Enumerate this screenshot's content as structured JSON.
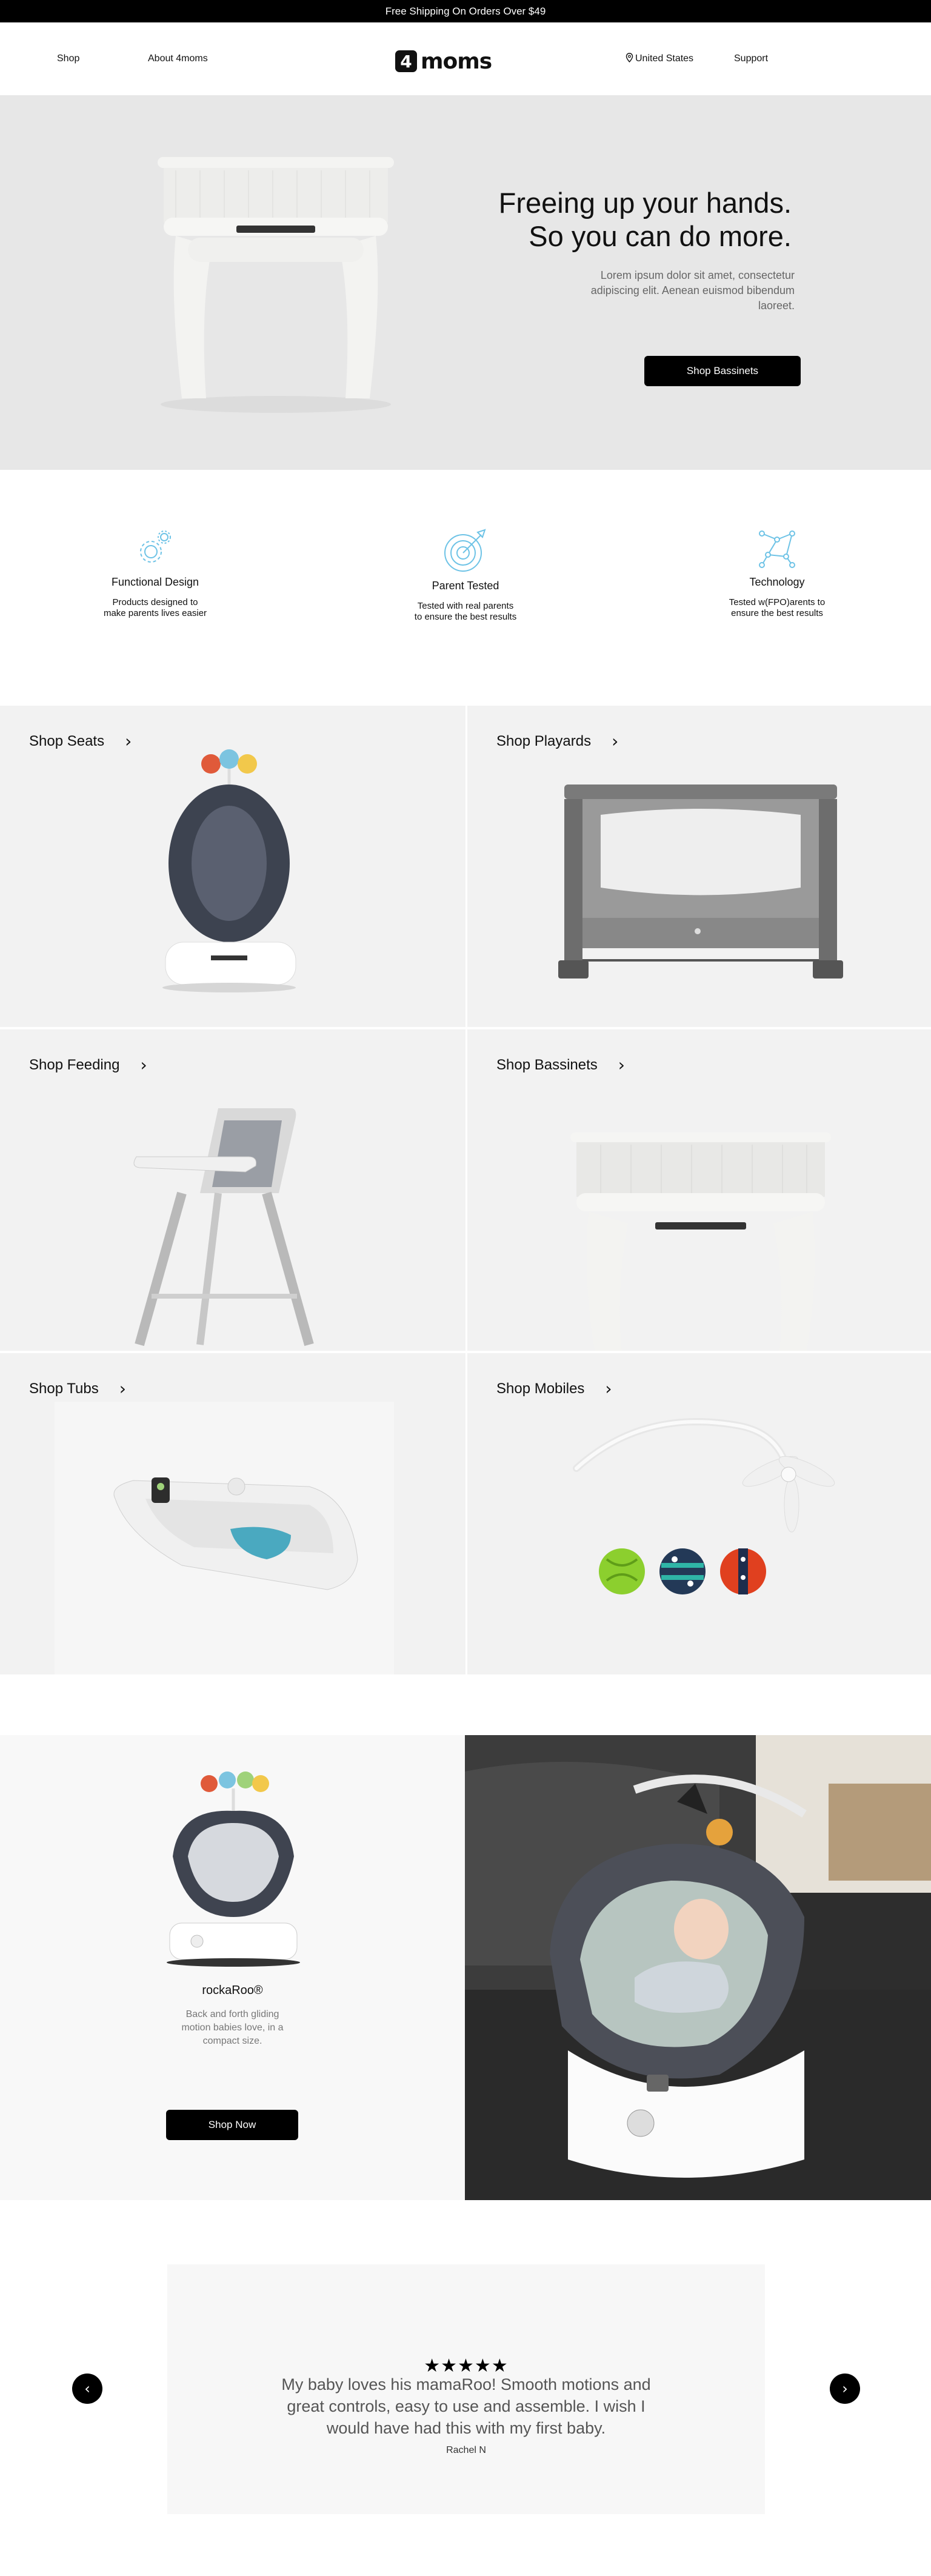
{
  "promo_bar": {
    "text": "Free Shipping On Orders Over $49"
  },
  "header": {
    "nav_left": [
      "Shop",
      "About 4moms"
    ],
    "logo": {
      "mark": "4",
      "text": "moms"
    },
    "nav_right": [
      "United States",
      "Support"
    ]
  },
  "hero": {
    "title_line1": "Freeing up your hands.",
    "title_line2": "So you can do more.",
    "body": "Lorem ipsum dolor sit amet, consectetur adipiscing elit. Aenean euismod bibendum laoreet.",
    "cta": "Shop Bassinets"
  },
  "features": [
    {
      "icon": "gear-icon",
      "title": "Functional Design",
      "desc_line1": "Products designed to",
      "desc_line2": "make parents lives easier"
    },
    {
      "icon": "target-icon",
      "title": "Parent Tested",
      "desc_line1": "Tested with real parents",
      "desc_line2": "to ensure the best results"
    },
    {
      "icon": "network-icon",
      "title": "Technology",
      "desc_line1": "Tested w(FPO)arents to",
      "desc_line2": "ensure the best results"
    }
  ],
  "categories": [
    {
      "label": "Shop Seats"
    },
    {
      "label": "Shop Playards"
    },
    {
      "label": "Shop Feeding"
    },
    {
      "label": "Shop Bassinets"
    },
    {
      "label": "Shop Tubs"
    },
    {
      "label": "Shop Mobiles"
    }
  ],
  "featured_product": {
    "name": "rockaRoo®",
    "desc_line1": "Back and forth gliding",
    "desc_line2": "motion babies love, in a",
    "desc_line3": "compact size.",
    "cta": "Shop Now"
  },
  "review": {
    "stars": "★★★★★",
    "quote": "My baby loves his mamaRoo! Smooth motions and great controls, easy to use and assemble. I wish I would have had this with my first baby.",
    "author": "Rachel N",
    "prev_icon": "chevron-left-icon",
    "next_icon": "chevron-right-icon"
  },
  "colors": {
    "promo_bg": "#000000",
    "hero_bg": "#e7e7e7",
    "tile_bg": "#f2f2f2",
    "icon_accent": "#6ec3e6",
    "button_bg": "#000000"
  }
}
